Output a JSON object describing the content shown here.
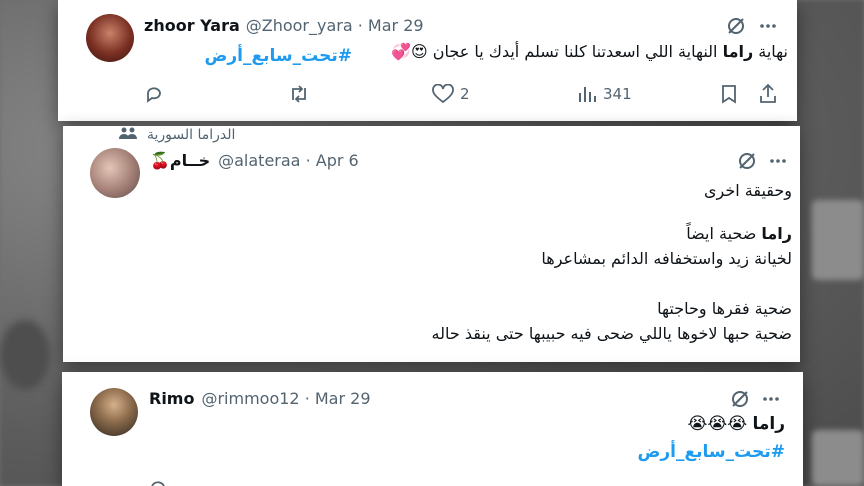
{
  "tweets": [
    {
      "display_name": "zhoor Yara",
      "handle_date": "@Zhoor_yara · Mar 29",
      "text_line1_a": "نهاية ",
      "text_line1_bold": "راما",
      "text_line1_b": " النهاية اللي اسعدتنا كلنا تسلم أيدك يا عجان ",
      "text_line1_emoji": "😍💞",
      "hashtag": "#تحت_سابع_أرض",
      "likes": "2",
      "views": "341"
    },
    {
      "community": "الدراما السورية",
      "display_name": "خــام🍒",
      "handle_date": "@alateraa · Apr 6",
      "line1": "وحقيقة اخرى",
      "line2_bold": "راما",
      "line2_rest": " ضحية ايضاً",
      "line3": "لخيانة زيد واستخفافه الدائم بمشاعرها",
      "line4": "ضحية فقرها وحاجتها",
      "line5": "ضحية حبها لاخوها ياللي ضحى فيه حبيبها حتى ينقذ حاله"
    },
    {
      "display_name": "Rimo",
      "handle_date": "@rimmoo12 · Mar 29",
      "line1_bold": "راما",
      "line1_emoji": " 😭😭😭",
      "hashtag": "#تحت_سابع_أرض"
    }
  ]
}
